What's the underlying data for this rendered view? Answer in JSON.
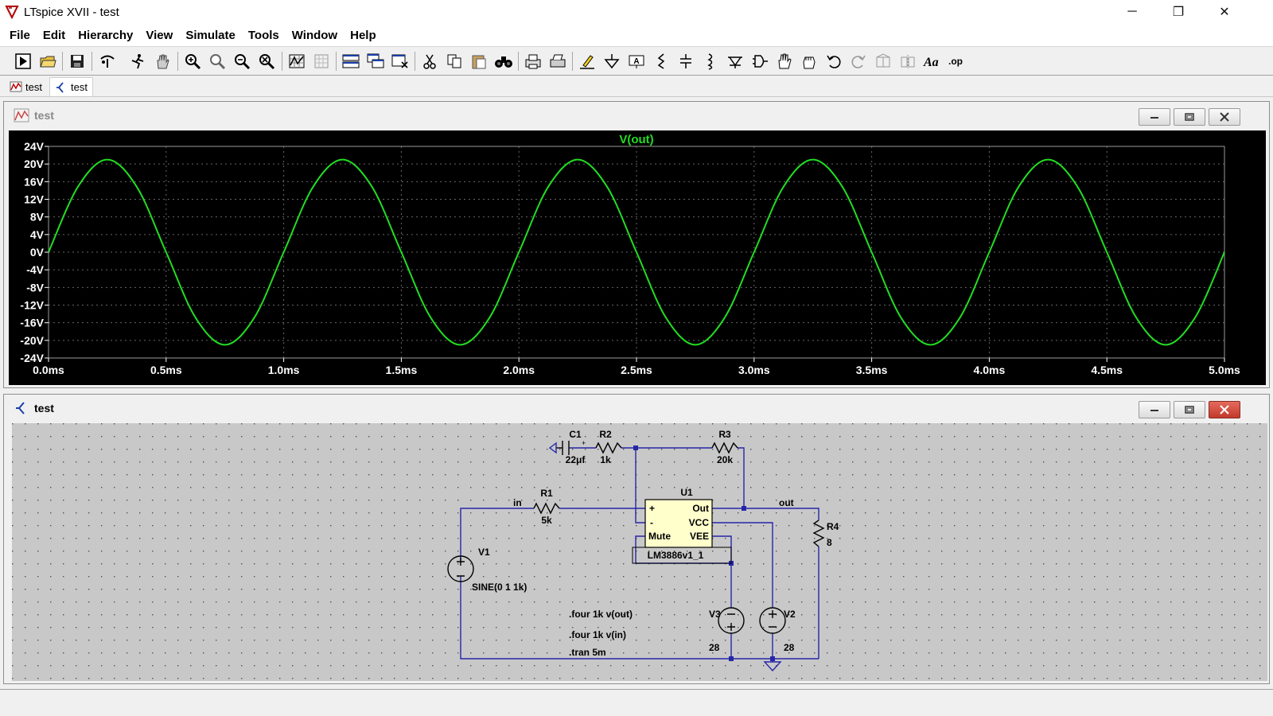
{
  "window": {
    "title": "LTspice XVII - test",
    "controls": {
      "minimize": "─",
      "maximize": "❐",
      "close": "✕"
    }
  },
  "menu": [
    "File",
    "Edit",
    "Hierarchy",
    "View",
    "Simulate",
    "Tools",
    "Window",
    "Help"
  ],
  "toolbar_icons": [
    "run-icon",
    "open-folder-icon",
    "save-icon",
    "control-panel-icon",
    "halt-icon",
    "pan-hand-icon",
    "zoom-in-icon",
    "zoom-full-icon",
    "zoom-out-icon",
    "zoom-cancel-icon",
    "autorange-icon",
    "grid-icon",
    "tile-horizontal-icon",
    "cascade-icon",
    "close-all-icon",
    "cut-icon",
    "copy-icon",
    "paste-icon",
    "find-icon",
    "print-icon",
    "print-setup-icon",
    "draw-wire-icon",
    "ground-icon",
    "label-net-icon",
    "resistor-icon",
    "capacitor-icon",
    "inductor-icon",
    "diode-icon",
    "component-icon",
    "move-icon",
    "drag-icon",
    "undo-icon",
    "redo-icon",
    "rotate-icon",
    "mirror-icon",
    "text-icon",
    "spice-directive-icon"
  ],
  "doc_tabs": [
    {
      "label": "test",
      "icon": "waveform-icon"
    },
    {
      "label": "test",
      "icon": "schematic-icon"
    }
  ],
  "plot_window": {
    "title": "test",
    "trace_label": "V(out)",
    "colors": {
      "background": "#000000",
      "trace": "#22dd22",
      "axis_text": "#ffffff",
      "grid": "#666666"
    }
  },
  "chart_data": {
    "type": "line",
    "title": "V(out)",
    "xlabel": "",
    "ylabel": "",
    "xlim": [
      0,
      5
    ],
    "ylim": [
      -24,
      24
    ],
    "x_ticks": [
      "0.0ms",
      "0.5ms",
      "1.0ms",
      "1.5ms",
      "2.0ms",
      "2.5ms",
      "3.0ms",
      "3.5ms",
      "4.0ms",
      "4.5ms",
      "5.0ms"
    ],
    "y_ticks": [
      "24V",
      "20V",
      "16V",
      "12V",
      "8V",
      "4V",
      "0V",
      "-4V",
      "-8V",
      "-12V",
      "-16V",
      "-20V",
      "-24V"
    ],
    "grid": true,
    "series": [
      {
        "name": "V(out)",
        "x_unit": "ms",
        "y_unit": "V",
        "x": [
          0,
          0.125,
          0.25,
          0.375,
          0.5,
          0.625,
          0.75,
          0.875,
          1.0,
          1.125,
          1.25,
          1.375,
          1.5,
          1.625,
          1.75,
          1.875,
          2.0,
          2.125,
          2.25,
          2.375,
          2.5,
          2.625,
          2.75,
          2.875,
          3.0,
          3.125,
          3.25,
          3.375,
          3.5,
          3.625,
          3.75,
          3.875,
          4.0,
          4.125,
          4.25,
          4.375,
          4.5,
          4.625,
          4.75,
          4.875,
          5.0
        ],
        "y": [
          0,
          14.85,
          21,
          14.85,
          0,
          -14.85,
          -21,
          -14.85,
          0,
          14.85,
          21,
          14.85,
          0,
          -14.85,
          -21,
          -14.85,
          0,
          14.85,
          21,
          14.85,
          0,
          -14.85,
          -21,
          -14.85,
          0,
          14.85,
          21,
          14.85,
          0,
          -14.85,
          -21,
          -14.85,
          0,
          14.85,
          21,
          14.85,
          0,
          -14.85,
          -21,
          -14.85,
          0
        ]
      }
    ]
  },
  "schematic_window": {
    "title": "test",
    "colors": {
      "background": "#c8c8c8",
      "wire": "#2626a8",
      "part": "#000000",
      "text": "#000000",
      "ic_fill": "#ffffcc"
    },
    "components": {
      "C1": {
        "name": "C1",
        "value": "22μf"
      },
      "R2": {
        "name": "R2",
        "value": "1k"
      },
      "R3": {
        "name": "R3",
        "value": "20k"
      },
      "R1": {
        "name": "R1",
        "value": "5k"
      },
      "R4": {
        "name": "R4",
        "value": "8"
      },
      "U1": {
        "name": "U1",
        "model": "LM3886v1_1",
        "pins": {
          "plus": "+",
          "minus": "-",
          "mute": "Mute",
          "out": "Out",
          "vcc": "VCC",
          "vee": "VEE"
        }
      },
      "V1": {
        "name": "V1",
        "value": "SINE(0 1 1k)"
      },
      "V2": {
        "name": "V2",
        "value": "28"
      },
      "V3": {
        "name": "V3",
        "value": "28"
      }
    },
    "nets": {
      "in": "in",
      "out": "out"
    },
    "directives": [
      ".four 1k v(out)",
      ".four 1k v(in)",
      ".tran 5m"
    ]
  }
}
